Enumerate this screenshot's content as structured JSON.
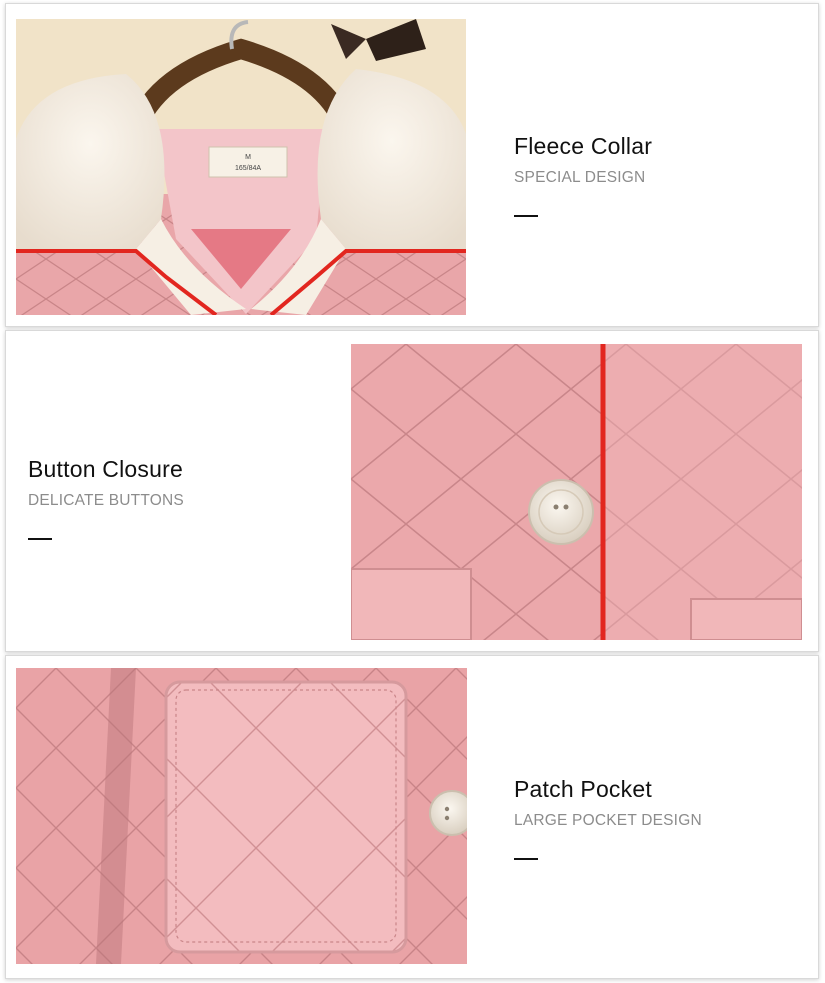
{
  "features": [
    {
      "title": "Fleece Collar",
      "subtitle": "SPECIAL DESIGN",
      "photo_alt": "fleece-collar-photo",
      "tag_lines": [
        "M",
        "165/84A"
      ]
    },
    {
      "title": "Button Closure",
      "subtitle": "DELICATE BUTTONS",
      "photo_alt": "button-closure-photo"
    },
    {
      "title": "Patch Pocket",
      "subtitle": "LARGE POCKET DESIGN",
      "photo_alt": "patch-pocket-photo"
    }
  ],
  "colors": {
    "fabric_pink": "#e8a3a6",
    "fabric_pink_light": "#f2b9bb",
    "fleece_cream": "#f4ece1",
    "piping_red": "#e2261f",
    "button_cream": "#f1ebe0",
    "wall_beige": "#f1e3c8",
    "hanger_brown": "#5c3a1d"
  }
}
